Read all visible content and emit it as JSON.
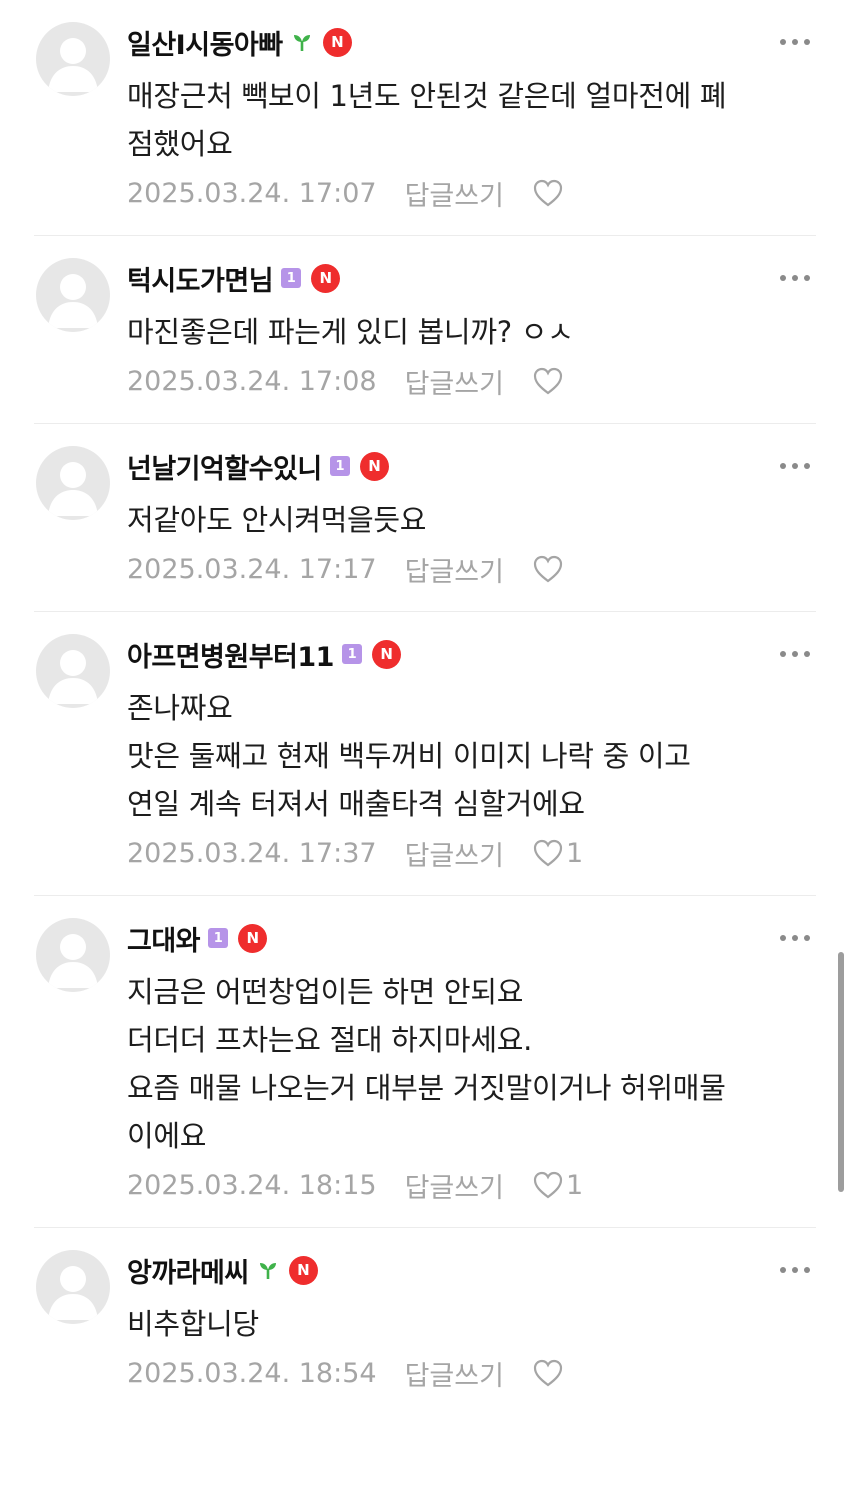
{
  "comments": [
    {
      "nickname": "일산I시동아빠",
      "level": "",
      "lines": [
        "매장근처 빽보이 1년도 안된것 같은데 얼마전에 폐",
        "점했어요"
      ],
      "date": "2025.03.24. 17:07",
      "reply_label": "답글쓰기",
      "likes": ""
    },
    {
      "nickname": "턱시도가면님",
      "level": "1",
      "lines": [
        "마진좋은데 파는게 있디 봅니까? ㅇㅅ"
      ],
      "date": "2025.03.24. 17:08",
      "reply_label": "답글쓰기",
      "likes": ""
    },
    {
      "nickname": "넌날기억할수있니",
      "level": "1",
      "lines": [
        "저같아도 안시켜먹을듯요"
      ],
      "date": "2025.03.24. 17:17",
      "reply_label": "답글쓰기",
      "likes": ""
    },
    {
      "nickname": "아프면병원부터11",
      "level": "1",
      "lines": [
        "존나짜요",
        "맛은 둘째고 현재 백두꺼비 이미지 나락 중 이고",
        "연일 계속 터져서 매출타격 심할거에요"
      ],
      "date": "2025.03.24. 17:37",
      "reply_label": "답글쓰기",
      "likes": "1"
    },
    {
      "nickname": "그대와",
      "level": "1",
      "lines": [
        "지금은 어떤창업이든 하면 안되요",
        "더더더 프차는요 절대 하지마세요.",
        "요즘 매물 나오는거 대부분 거짓말이거나 허위매물",
        "이에요"
      ],
      "date": "2025.03.24. 18:15",
      "reply_label": "답글쓰기",
      "likes": "1"
    },
    {
      "nickname": "앙까라메씨",
      "level": "",
      "lines": [
        "비추합니당"
      ],
      "date": "2025.03.24. 18:54",
      "reply_label": "답글쓰기",
      "likes": ""
    }
  ],
  "badge_n_label": "N",
  "icons": {
    "avatar": "default-avatar-icon",
    "more": "more-dots-icon",
    "like": "heart-outline-icon",
    "sprout": "sprout-icon",
    "level": "level-badge-icon",
    "naver": "naver-n-badge-icon"
  },
  "colors": {
    "badge_n": "#ef2d2d",
    "level_badge": "#b694e8",
    "sprout": "#3fb24a",
    "meta_text": "#a5a5a5"
  }
}
